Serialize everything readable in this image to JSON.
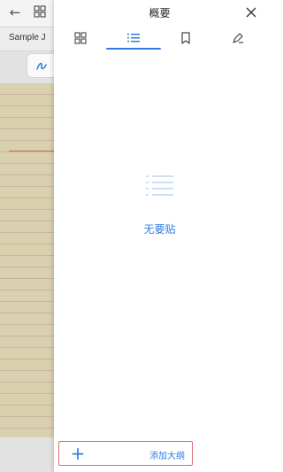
{
  "background_document": {
    "tab_title": "Sample J",
    "icons": {
      "back": "back-arrow-icon",
      "thumbnails": "grid-icon",
      "pen": "pen-icon"
    }
  },
  "panel": {
    "title": "概要",
    "close_icon": "close-icon",
    "tabs": [
      {
        "icon": "grid-view-icon",
        "selected": false
      },
      {
        "icon": "outline-list-icon",
        "selected": true
      },
      {
        "icon": "bookmark-icon",
        "selected": false
      },
      {
        "icon": "annotation-pen-icon",
        "selected": false
      }
    ],
    "empty_state": {
      "icon": "outline-list-icon",
      "text": "无要贴"
    },
    "add_bar": {
      "plus": "+",
      "label": "添加大纲"
    }
  },
  "colors": {
    "accent": "#2f7de1",
    "highlight_border": "#e06a74",
    "paper": "#d8d0ae"
  }
}
